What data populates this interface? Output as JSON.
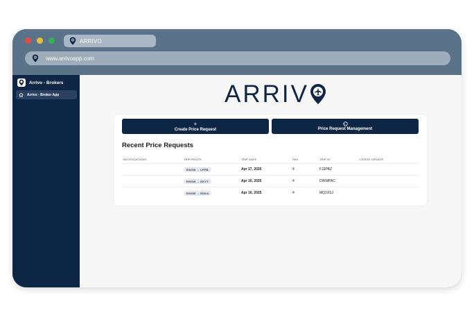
{
  "browser": {
    "tab_title": "ARRIVO",
    "url": "www.arrivoapp.com"
  },
  "sidebar": {
    "title": "Arrivo - Brokers",
    "items": [
      {
        "label": "Arrivo - Broker App",
        "icon": "home-icon",
        "active": true
      }
    ]
  },
  "main": {
    "logo_text": "ARRIV",
    "buttons": {
      "create_label": "Create Price Request",
      "create_icon": "+",
      "manage_label": "Price Request Management"
    },
    "section_title": "Recent Price Requests",
    "table": {
      "headers": [
        "NOTIFICATIONS",
        "TRIP ROUTE",
        "TRIP DATE",
        "PAX",
        "TRIP ID",
        "LATEST UPDATE"
      ],
      "rows": [
        {
          "notifications": "",
          "route": "EGGW → LFPB",
          "date": "Apr 17, 2025",
          "pax": "4",
          "trip_id": "FJ3PBZ",
          "latest_update": ""
        },
        {
          "notifications": "",
          "route": "EGGW → EKYT",
          "date": "Apr 16, 2025",
          "pax": "4",
          "trip_id": "DWWPAC",
          "latest_update": ""
        },
        {
          "notifications": "",
          "route": "EGGW → EDKA",
          "date": "Apr 16, 2025",
          "pax": "4",
          "trip_id": "MQ1XSJ",
          "latest_update": ""
        }
      ]
    }
  },
  "colors": {
    "navy": "#0e2646",
    "chrome": "#5b7389",
    "main_bg": "#f7f7f8"
  }
}
